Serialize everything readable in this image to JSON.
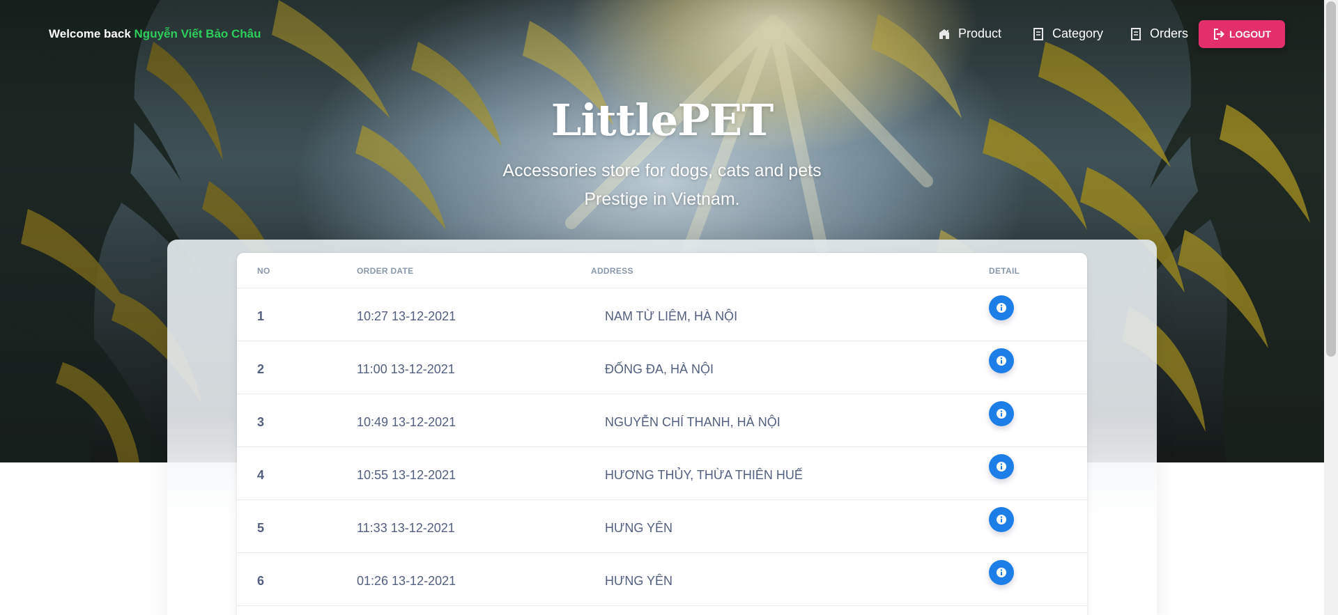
{
  "navbar": {
    "welcome_prefix": "Welcome back",
    "username": "Nguyễn Viết Bảo Châu",
    "items": [
      {
        "label": "Product",
        "icon": "shop-icon"
      },
      {
        "label": "Category",
        "icon": "document-icon"
      },
      {
        "label": "Orders",
        "icon": "document-icon"
      }
    ],
    "logout_label": "LOGOUT"
  },
  "hero": {
    "brand": "LittlePET",
    "tagline_line1": "Accessories store for dogs, cats and pets",
    "tagline_line2": "Prestige in Vietnam."
  },
  "table": {
    "headers": [
      "NO",
      "ORDER DATE",
      "ADDRESS",
      "DETAIL"
    ],
    "rows": [
      {
        "no": "1",
        "date": "10:27 13-12-2021",
        "address": "NAM TỪ LIÊM, HÀ NỘI"
      },
      {
        "no": "2",
        "date": "11:00 13-12-2021",
        "address": "ĐỐNG ĐA, HÀ NỘI"
      },
      {
        "no": "3",
        "date": "10:49 13-12-2021",
        "address": "NGUYỄN CHÍ THANH, HÀ NỘI"
      },
      {
        "no": "4",
        "date": "10:55 13-12-2021",
        "address": "HƯƠNG THỦY, THỪA THIÊN HUẾ"
      },
      {
        "no": "5",
        "date": "11:33 13-12-2021",
        "address": "HƯNG YÊN"
      },
      {
        "no": "6",
        "date": "01:26 13-12-2021",
        "address": "HƯNG YÊN"
      }
    ],
    "detail_icon": "info-icon"
  },
  "colors": {
    "username": "#2dce5a",
    "logout": "#e3306c",
    "detail_button": "#1d7ee8",
    "table_text": "#525f7f",
    "header_text": "#8898aa"
  }
}
